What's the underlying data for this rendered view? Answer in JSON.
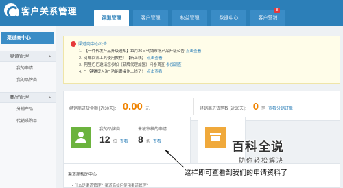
{
  "app": {
    "title": "客户关系管理"
  },
  "nav": {
    "tabs": [
      {
        "label": "渠道管理",
        "active": true
      },
      {
        "label": "客户管理",
        "active": false
      },
      {
        "label": "权益管理",
        "active": false
      },
      {
        "label": "数据中心",
        "active": false
      },
      {
        "label": "客户营销",
        "active": false,
        "badge": "8"
      }
    ]
  },
  "sidebar": {
    "title": "渠道商中心",
    "groups": [
      {
        "label": "渠道管理",
        "items": [
          "我的申请",
          "我的品牌商"
        ]
      },
      {
        "label": "商品管理",
        "items": [
          "分销产品",
          "代销采购单"
        ]
      }
    ]
  },
  "notice": {
    "title": "渠道商中心公告：",
    "items": [
      {
        "num": "1.",
        "text": "【一件代发产品升级通知】11月26日代销市场产品升级公告",
        "link": "点击查看"
      },
      {
        "num": "2.",
        "text": "订单回流工具使用教程！【新上线】",
        "link": "点击查看"
      },
      {
        "num": "3.",
        "text": "阿里巴巴邀请您参加《品牌代理加盟》问卷调查",
        "link": "参加调查"
      },
      {
        "num": "4.",
        "text": "\"一键铺货入淘\" 功能跟操作上线了！",
        "link": "点击查看"
      }
    ]
  },
  "stats": {
    "amount_label": "经销商进货金额 [近30天]：",
    "amount_value": "0.00",
    "amount_unit": "元",
    "count_label": "经销商进货笔数 [近30天]：",
    "count_value": "0",
    "count_unit": "笔",
    "count_link": "查看分销订单"
  },
  "brand_card": {
    "brands_label": "我的品牌商",
    "brands_value": "12",
    "brands_unit": "位",
    "brands_link": "查看",
    "pending_label": "未被审核的申请",
    "pending_value": "8",
    "pending_unit": "条",
    "pending_link": "查看"
  },
  "help": {
    "title": "渠道商帮助中心",
    "item": "• 什么是渠道管理？渠道商如何使用渠道管理？"
  },
  "caption": "这样即可查看到我们的申请资料了",
  "watermark": {
    "main": "百科全说",
    "sub": "助你轻松解决"
  },
  "colors": {
    "header": "#2c7fb8",
    "accent": "#f08300",
    "link": "#2c7fb8"
  }
}
